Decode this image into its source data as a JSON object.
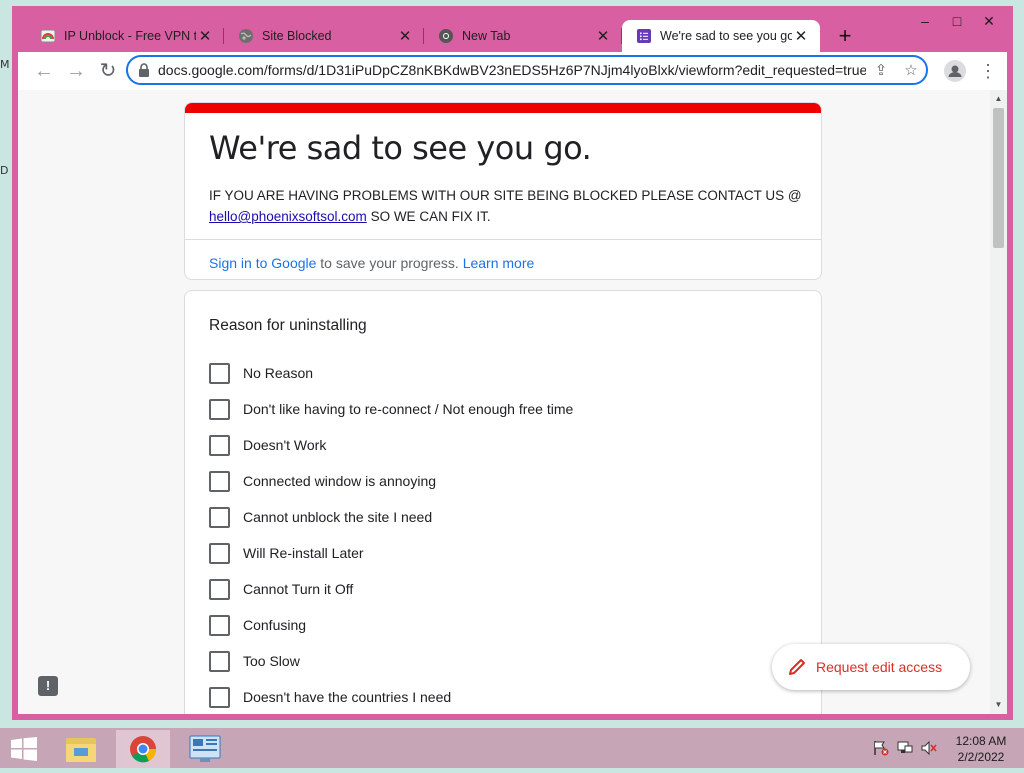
{
  "desktop": {
    "fragment_top": "M",
    "fragment_mid": "D"
  },
  "browser": {
    "tabs": [
      {
        "title": "IP Unblock - Free VPN to",
        "active": false
      },
      {
        "title": "Site Blocked",
        "active": false
      },
      {
        "title": "New Tab",
        "active": false
      },
      {
        "title": "We're sad to see you go.",
        "active": true
      }
    ],
    "new_tab_label": "+",
    "window_controls": {
      "minimize": "–",
      "maximize": "□",
      "close": "✕"
    },
    "url": "docs.google.com/forms/d/1D31iPuDpCZ8nKBKdwBV23nEDS5Hz6P7NJjm4lyoBlxk/viewform?edit_requested=true"
  },
  "form": {
    "title": "We're sad to see you go.",
    "description_prefix": "IF YOU ARE HAVING PROBLEMS WITH OUR SITE BEING BLOCKED PLEASE CONTACT US @",
    "email": "hello@phoenixsoftsol.com",
    "description_suffix": "SO WE CAN FIX IT.",
    "signin_link": "Sign in to Google",
    "signin_text": "to save your progress.",
    "learn_more": "Learn more",
    "question": {
      "title": "Reason for uninstalling",
      "options": [
        "No Reason",
        "Don't like having to re-connect / Not enough free time",
        "Doesn't Work",
        "Connected window is annoying",
        "Cannot unblock the site I need",
        "Will Re-install Later",
        "Cannot Turn it Off",
        "Confusing",
        "Too Slow",
        "Doesn't have the countries I need"
      ]
    },
    "request_edit_label": "Request edit access",
    "feedback_glyph": "!"
  },
  "taskbar": {
    "clock_time": "12:08 AM",
    "clock_date": "2/2/2022"
  },
  "colors": {
    "window_frame": "#d85fa1",
    "form_accent": "#ee0000",
    "link": "#1a73e8",
    "request_edit": "#d93025"
  }
}
